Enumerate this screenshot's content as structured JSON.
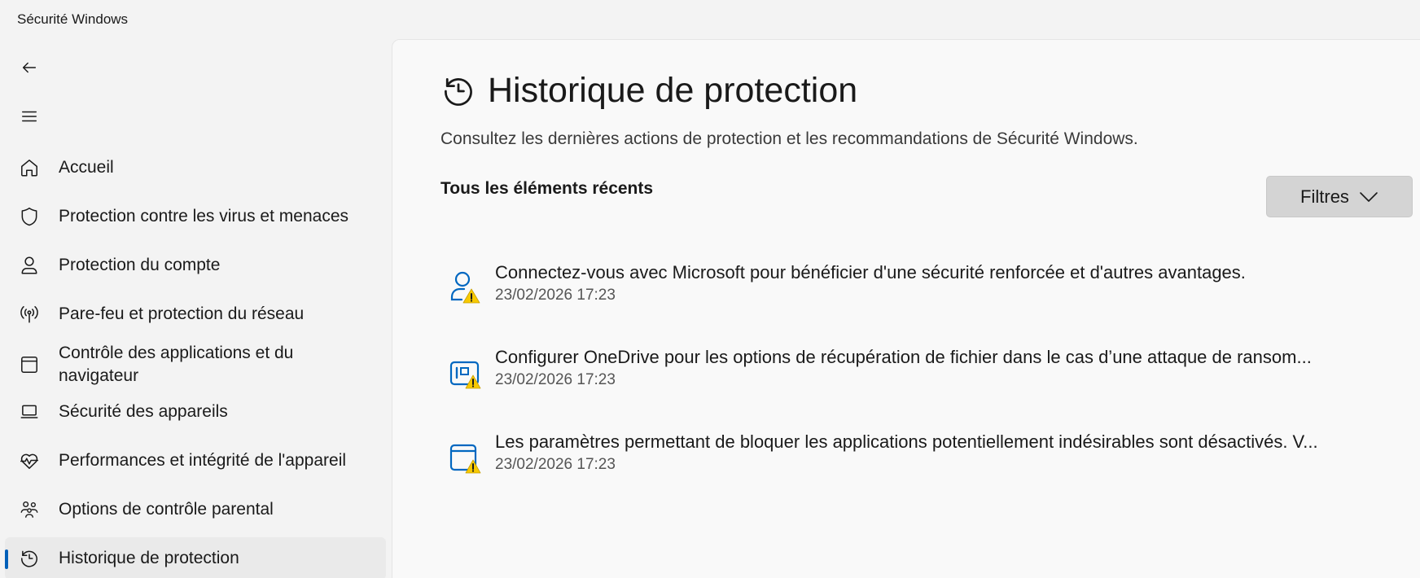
{
  "app": {
    "title": "Sécurité Windows"
  },
  "sidebar": {
    "items": [
      {
        "label": "Accueil",
        "icon": "home-icon"
      },
      {
        "label": "Protection contre les virus et menaces",
        "icon": "shield-icon"
      },
      {
        "label": "Protection du compte",
        "icon": "person-icon"
      },
      {
        "label": "Pare-feu et protection du réseau",
        "icon": "antenna-icon"
      },
      {
        "label": "Contrôle des applications et du navigateur",
        "icon": "browser-window-icon"
      },
      {
        "label": "Sécurité des appareils",
        "icon": "laptop-icon"
      },
      {
        "label": "Performances et intégrité de l'appareil",
        "icon": "heart-pulse-icon"
      },
      {
        "label": "Options de contrôle parental",
        "icon": "family-icon"
      },
      {
        "label": "Historique de protection",
        "icon": "history-icon",
        "selected": true
      }
    ]
  },
  "main": {
    "title": "Historique de protection",
    "description": "Consultez les dernières actions de protection et les recommandations de Sécurité Windows.",
    "section_title": "Tous les éléments récents",
    "filter_label": "Filtres",
    "history": [
      {
        "title": "Connectez-vous avec Microsoft pour bénéficier d'une sécurité renforcée et d'autres avantages.",
        "time": "23/02/2026 17:23",
        "icon": "account-warning-icon"
      },
      {
        "title": "Configurer OneDrive pour les options de récupération de fichier dans le cas d’une attaque de ransom...",
        "time": "23/02/2026 17:23",
        "icon": "ransomware-warning-icon"
      },
      {
        "title": "Les paramètres permettant de bloquer les applications potentiellement indésirables sont désactivés. V...",
        "time": "23/02/2026 17:23",
        "icon": "app-browser-warning-icon"
      }
    ]
  },
  "colors": {
    "accent": "#005fb8",
    "warning": "#f7c900",
    "icon_blue": "#0067c0"
  }
}
